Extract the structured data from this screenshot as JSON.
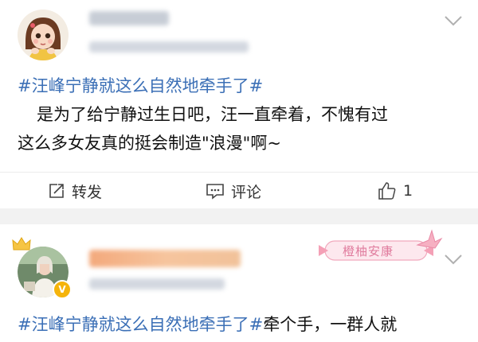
{
  "post1": {
    "hashtag": "#汪峰宁静就这么自然地牵手了#",
    "text_line1": "是为了给宁静过生日吧，汪一直牵着，不愧有过",
    "text_line2": "这么多女友真的挺会制造\"浪漫\"啊~",
    "actions": {
      "repost_label": "转发",
      "comment_label": "评论",
      "like_count": "1"
    }
  },
  "post2": {
    "tag_label": "橙柚安康",
    "verified_badge": "V",
    "hashtag": "#汪峰宁静就这么自然地牵手了#",
    "text_tail": "牵个手，一群人就"
  },
  "icons": [
    "chevron-down-icon",
    "repost-icon",
    "comment-icon",
    "like-icon",
    "verified-icon"
  ],
  "colors": {
    "topic": "#3b6fb6",
    "separator": "#f2f2f2",
    "badge": "#f5b40b"
  }
}
